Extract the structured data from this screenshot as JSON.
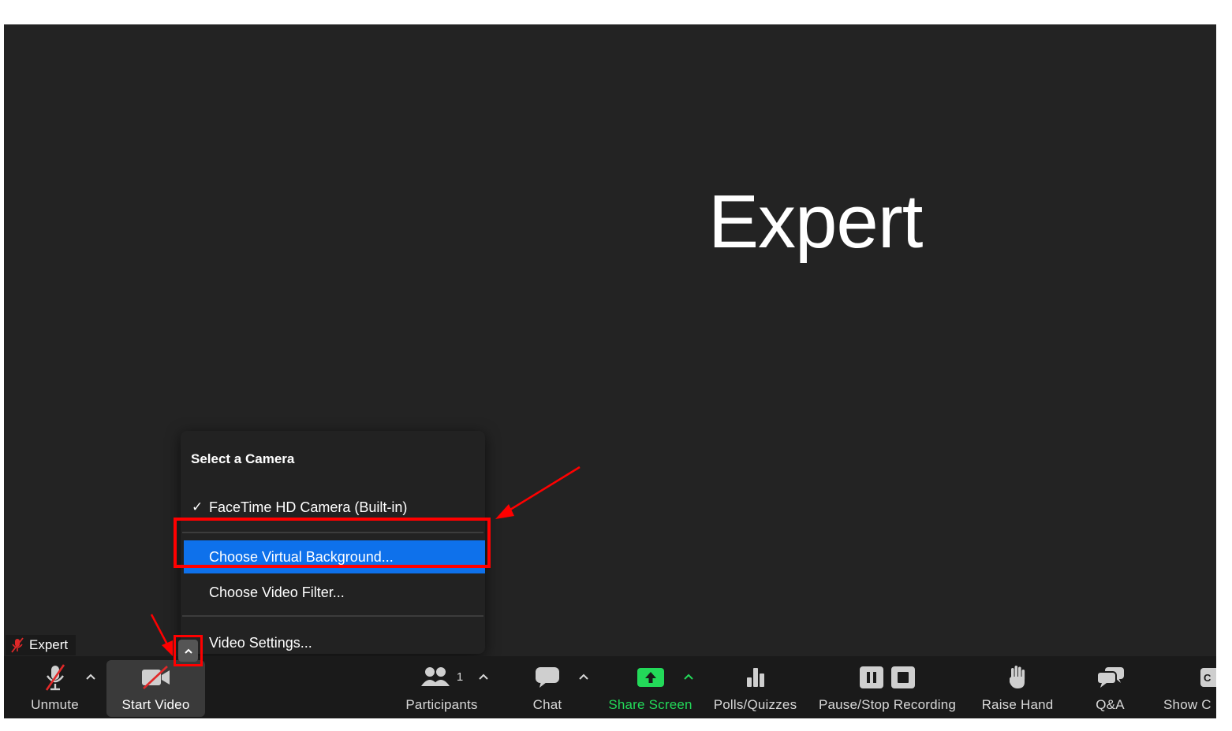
{
  "meeting": {
    "speaker_display_name": "Expert",
    "name_tag": "Expert"
  },
  "camera_menu": {
    "heading": "Select a Camera",
    "camera_option": "FaceTime HD Camera (Built-in)",
    "camera_option_checked": true,
    "virtual_background": "Choose Virtual Background...",
    "video_filter": "Choose Video Filter...",
    "video_settings": "Video Settings..."
  },
  "toolbar": {
    "unmute": "Unmute",
    "start_video": "Start Video",
    "participants": "Participants",
    "participants_count": "1",
    "chat": "Chat",
    "share_screen": "Share Screen",
    "polls": "Polls/Quizzes",
    "recording": "Pause/Stop Recording",
    "raise_hand": "Raise Hand",
    "qa": "Q&A",
    "show_captions": "Show C"
  },
  "colors": {
    "background": "#232323",
    "toolbar": "#1a1a1a",
    "menu_highlight": "#0e71eb",
    "share_green": "#23d959",
    "annotation_red": "#ff0000"
  }
}
